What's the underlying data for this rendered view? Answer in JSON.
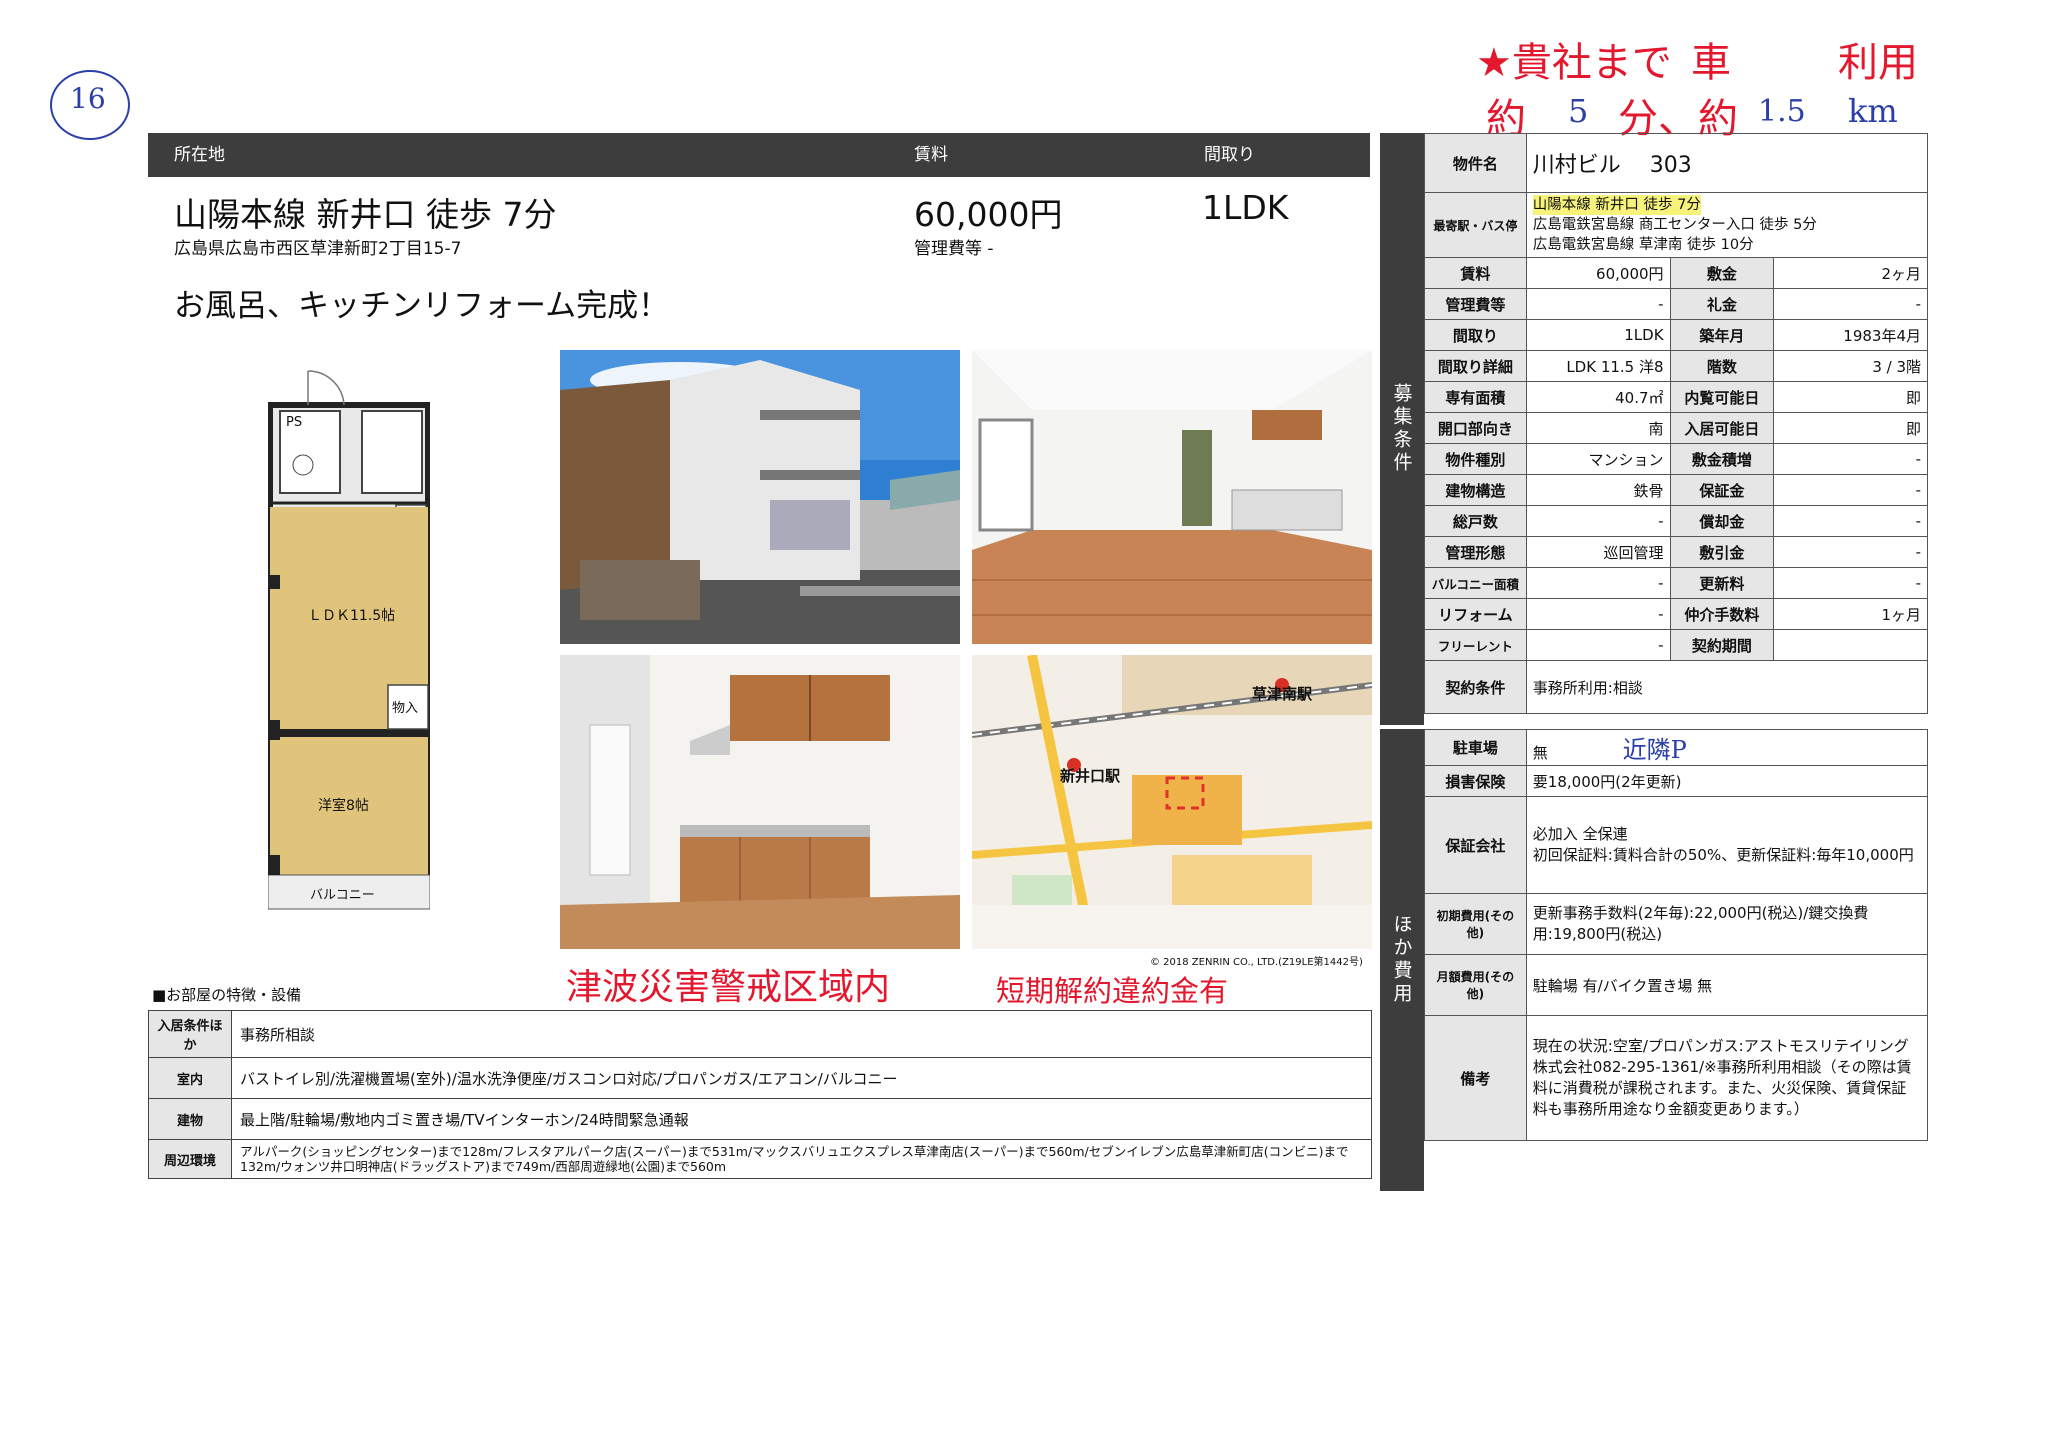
{
  "page_number": "16",
  "handwritten_note": {
    "line1_prefix": "★貴社まで",
    "line1_mode": "車",
    "line1_suffix": "利用",
    "line2_a": "約",
    "line2_min": "5",
    "line2_b": "分、約",
    "line2_km": "1.5",
    "line2_unit": "km"
  },
  "header": {
    "location_label": "所在地",
    "rent_label": "賃料",
    "layout_label": "間取り",
    "station": "山陽本線 新井口 徒歩 7分",
    "address": "広島県広島市西区草津新町2丁目15-7",
    "rent": "60,000円",
    "mgmt_fee": "管理費等 -",
    "layout": "1LDK"
  },
  "headline": "お風呂、キッチンリフォーム完成！",
  "floorplan": {
    "ps": "PS",
    "ldk": "ＬＤＫ11.5帖",
    "storage": "物入",
    "western": "洋室8帖",
    "balcony": "バルコニー"
  },
  "map": {
    "station_main": "新井口駅",
    "station_north": "草津南駅",
    "copyright": "© 2018 ZENRIN CO., LTD.(Z19LE第1442号)"
  },
  "warnings": {
    "tsunami": "津波災害警戒区域内",
    "penalty": "短期解約違約金有"
  },
  "features": {
    "title": "■お部屋の特徴・設備",
    "rows": [
      {
        "label": "入居条件ほか",
        "value": "事務所相談"
      },
      {
        "label": "室内",
        "value": "バストイレ別/洗濯機置場(室外)/温水洗浄便座/ガスコンロ対応/プロパンガス/エアコン/バルコニー"
      },
      {
        "label": "建物",
        "value": "最上階/駐輪場/敷地内ゴミ置き場/TVインターホン/24時間緊急通報"
      },
      {
        "label": "周辺環境",
        "value": "アルパーク(ショッピングセンター)まで128m/フレスタアルパーク店(スーパー)まで531m/マックスバリュエクスプレス草津南店(スーパー)まで560m/セブンイレブン広島草津新町店(コンビニ)まで132m/ウォンツ井口明神店(ドラッグストア)まで749m/西部周遊緑地(公園)まで560m"
      }
    ]
  },
  "side_section1": "募集条件",
  "side_section2": "ほか費用",
  "spec": {
    "property_label": "物件名",
    "property_name": "川村ビル　 303",
    "access_label": "最寄駅・バス停",
    "access": [
      "山陽本線 新井口 徒歩 7分",
      "広島電鉄宮島線 商工センター入口 徒歩 5分",
      "広島電鉄宮島線 草津南 徒歩 10分"
    ],
    "rows": [
      [
        "賃料",
        "60,000円",
        "敷金",
        "2ヶ月"
      ],
      [
        "管理費等",
        "-",
        "礼金",
        "-"
      ],
      [
        "間取り",
        "1LDK",
        "築年月",
        "1983年4月"
      ],
      [
        "間取り詳細",
        "LDK 11.5 洋8",
        "階数",
        "3 / 3階"
      ],
      [
        "専有面積",
        "40.7㎡",
        "内覧可能日",
        "即"
      ],
      [
        "開口部向き",
        "南",
        "入居可能日",
        "即"
      ],
      [
        "物件種別",
        "マンション",
        "敷金積増",
        "-"
      ],
      [
        "建物構造",
        "鉄骨",
        "保証金",
        "-"
      ],
      [
        "総戸数",
        "-",
        "償却金",
        "-"
      ],
      [
        "管理形態",
        "巡回管理",
        "敷引金",
        "-"
      ],
      [
        "バルコニー面積",
        "-",
        "更新料",
        "-"
      ],
      [
        "リフォーム",
        "-",
        "仲介手数料",
        "1ヶ月"
      ],
      [
        "フリーレント",
        "-",
        "契約期間",
        ""
      ]
    ],
    "contract_label": "契約条件",
    "contract": "事務所利用:相談"
  },
  "costs": {
    "parking_label": "駐車場",
    "parking": "無",
    "parking_note": "近隣P",
    "insurance_label": "損害保険",
    "insurance": "要18,000円(2年更新)",
    "guarantor_label": "保証会社",
    "guarantor": "必加入 全保連\n初回保証料:賃料合計の50%、更新保証料:毎年10,000円",
    "initial_label": "初期費用(その他)",
    "initial": "更新事務手数料(2年毎):22,000円(税込)/鍵交換費用:19,800円(税込)",
    "monthly_label": "月額費用(その他)",
    "monthly": "駐輪場 有/バイク置き場 無",
    "remarks_label": "備考",
    "remarks": "現在の状況:空室/プロパンガス:アストモスリテイリング株式会社082-295-1361/※事務所利用相談（その際は賃料に消費税が課税されます。また、火災保険、賃貸保証料も事務所用途なり金額変更あります。）"
  }
}
